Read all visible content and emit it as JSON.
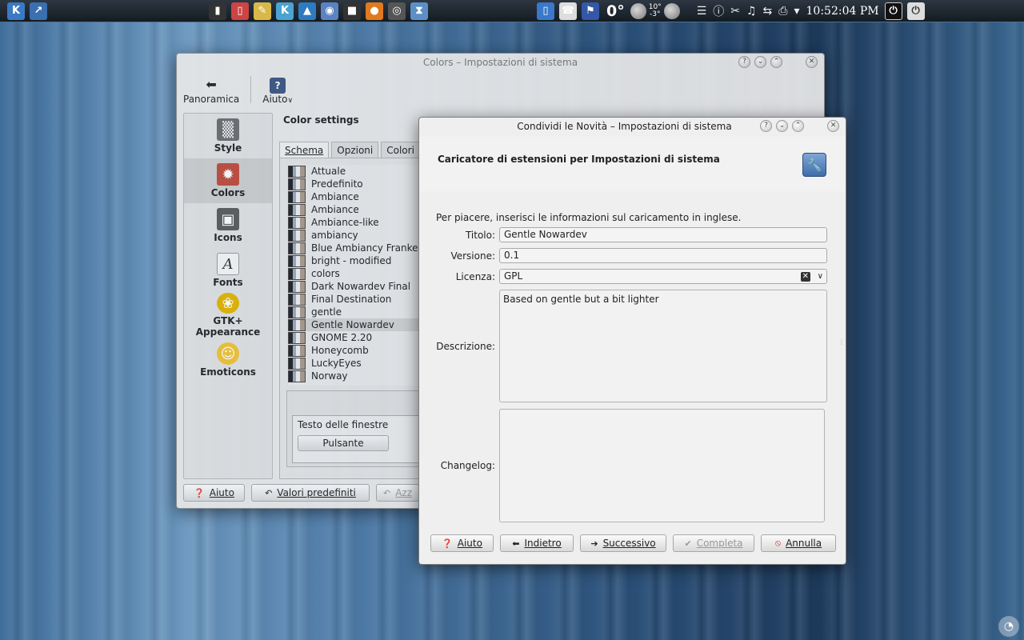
{
  "panel": {
    "launchers": [
      {
        "icon": "kde-menu-icon",
        "glyph": "K",
        "color": "#3c79c4"
      },
      {
        "icon": "desktop-icon",
        "glyph": "↗",
        "color": "#3a6fb0"
      }
    ],
    "tasks": [
      {
        "icon": "clipboard-icon",
        "glyph": "▮",
        "color": "#333"
      },
      {
        "icon": "bookmark-icon",
        "glyph": "▯",
        "color": "#c44"
      },
      {
        "icon": "notes-icon",
        "glyph": "✎",
        "color": "#d9b84a"
      },
      {
        "icon": "kde-app-icon",
        "glyph": "K",
        "color": "#4aa3d0"
      },
      {
        "icon": "system-monitor-icon",
        "glyph": "▲",
        "color": "#2e7bbf"
      },
      {
        "icon": "screenshot-icon",
        "glyph": "◉",
        "color": "#5b83c2"
      },
      {
        "icon": "terminal-icon",
        "glyph": "■",
        "color": "#333"
      },
      {
        "icon": "media-player-icon",
        "glyph": "●",
        "color": "#e07a1f"
      },
      {
        "icon": "webcam-icon",
        "glyph": "◎",
        "color": "#555"
      },
      {
        "icon": "hourglass-icon",
        "glyph": "⧗",
        "color": "#5d8fc7"
      }
    ],
    "tray_left": [
      {
        "icon": "bookmark-tray-icon",
        "glyph": "▯",
        "color": "#3a78c9"
      },
      {
        "icon": "phone-icon",
        "glyph": "☎",
        "color": "#ddd"
      },
      {
        "icon": "keyboard-layout-flag-icon",
        "glyph": "⚑",
        "color": "#3457a8"
      }
    ],
    "weather": {
      "temp": "0°",
      "hi": "10°",
      "lo": "-3°"
    },
    "tray_right": [
      {
        "icon": "window-list-icon",
        "glyph": "☰"
      },
      {
        "icon": "info-icon",
        "glyph": "ⓘ"
      },
      {
        "icon": "scissors-icon",
        "glyph": "✂"
      },
      {
        "icon": "volume-icon",
        "glyph": "♫"
      },
      {
        "icon": "usb-icon",
        "glyph": "⇆"
      },
      {
        "icon": "printer-icon",
        "glyph": "⎙"
      },
      {
        "icon": "tray-expand-icon",
        "glyph": "▾"
      }
    ],
    "clock": "10:52:04 PM"
  },
  "colors_window": {
    "title": "Colors – Impostazioni di sistema",
    "toolbar": {
      "overview_label": "Panoramica",
      "help_label": "Aiuto"
    },
    "sidebar": [
      {
        "label": "Style",
        "icon": "style-suit-icon",
        "glyph": "▒",
        "bg": "#6c6c6c"
      },
      {
        "label": "Colors",
        "icon": "colors-palette-icon",
        "glyph": "✹",
        "bg": "#c04a3a"
      },
      {
        "label": "Icons",
        "icon": "icons-cube-icon",
        "glyph": "▣",
        "bg": "#5a5a5a"
      },
      {
        "label": "Fonts",
        "icon": "fonts-letter-icon",
        "glyph": "A",
        "bg": "#f5f5f5"
      },
      {
        "label": "GTK+ Appearance",
        "icon": "gtk-gnome-foot-icon",
        "glyph": "❀",
        "bg": "#e2b400"
      },
      {
        "label": "Emoticons",
        "icon": "emoticon-smiley-icon",
        "glyph": "☺",
        "bg": "#f1c232"
      }
    ],
    "heading": "Color settings",
    "tabs": [
      "Schema",
      "Opzioni",
      "Colori"
    ],
    "schemes": [
      "Attuale",
      "Predefinito",
      "Ambiance",
      "Ambiance",
      "Ambiance-like",
      "ambiancy",
      "Blue Ambiancy Franke",
      "bright - modified",
      "colors",
      "Dark Nowardev Final",
      "Final Destination",
      "gentle",
      "Gentle Nowardev",
      "GNOME 2.20",
      "Honeycomb",
      "LuckyEyes",
      "Norway"
    ],
    "selected_scheme": "Gentle Nowardev",
    "preview": {
      "window_text": "Testo delle finestre",
      "button": "Pulsante"
    },
    "bottom_buttons": [
      {
        "label": "Aiuto",
        "icon": "help-icon",
        "glyph": "❓"
      },
      {
        "label": "Valori predefiniti",
        "icon": "defaults-icon",
        "glyph": "↶"
      },
      {
        "label": "Azz",
        "icon": "reset-icon",
        "glyph": "↶"
      }
    ]
  },
  "upload_dialog": {
    "title": "Condividi le Novità – Impostazioni di sistema",
    "header_title": "Caricatore di estensioni per Impostazioni di sistema",
    "intro": "Per piacere, inserisci le informazioni sul caricamento in inglese.",
    "fields": {
      "title_label": "Titolo:",
      "title_value": "Gentle Nowardev",
      "version_label": "Versione:",
      "version_value": "0.1",
      "license_label": "Licenza:",
      "license_value": "GPL",
      "description_label": "Descrizione:",
      "description_value": "Based on gentle but a bit lighter",
      "changelog_label": "Changelog:",
      "changelog_value": ""
    },
    "buttons": [
      {
        "key": "help",
        "label": "Aiuto",
        "icon": "help-icon",
        "glyph": "❓",
        "enabled": true
      },
      {
        "key": "back",
        "label": "Indietro",
        "icon": "arrow-left-icon",
        "glyph": "⬅",
        "enabled": true
      },
      {
        "key": "next",
        "label": "Successivo",
        "icon": "arrow-right-icon",
        "glyph": "➔",
        "enabled": true
      },
      {
        "key": "finish",
        "label": "Completa",
        "icon": "checkmark-icon",
        "glyph": "✔",
        "enabled": false
      },
      {
        "key": "cancel",
        "label": "Annulla",
        "icon": "cancel-icon",
        "glyph": "⦸",
        "enabled": true
      }
    ]
  }
}
